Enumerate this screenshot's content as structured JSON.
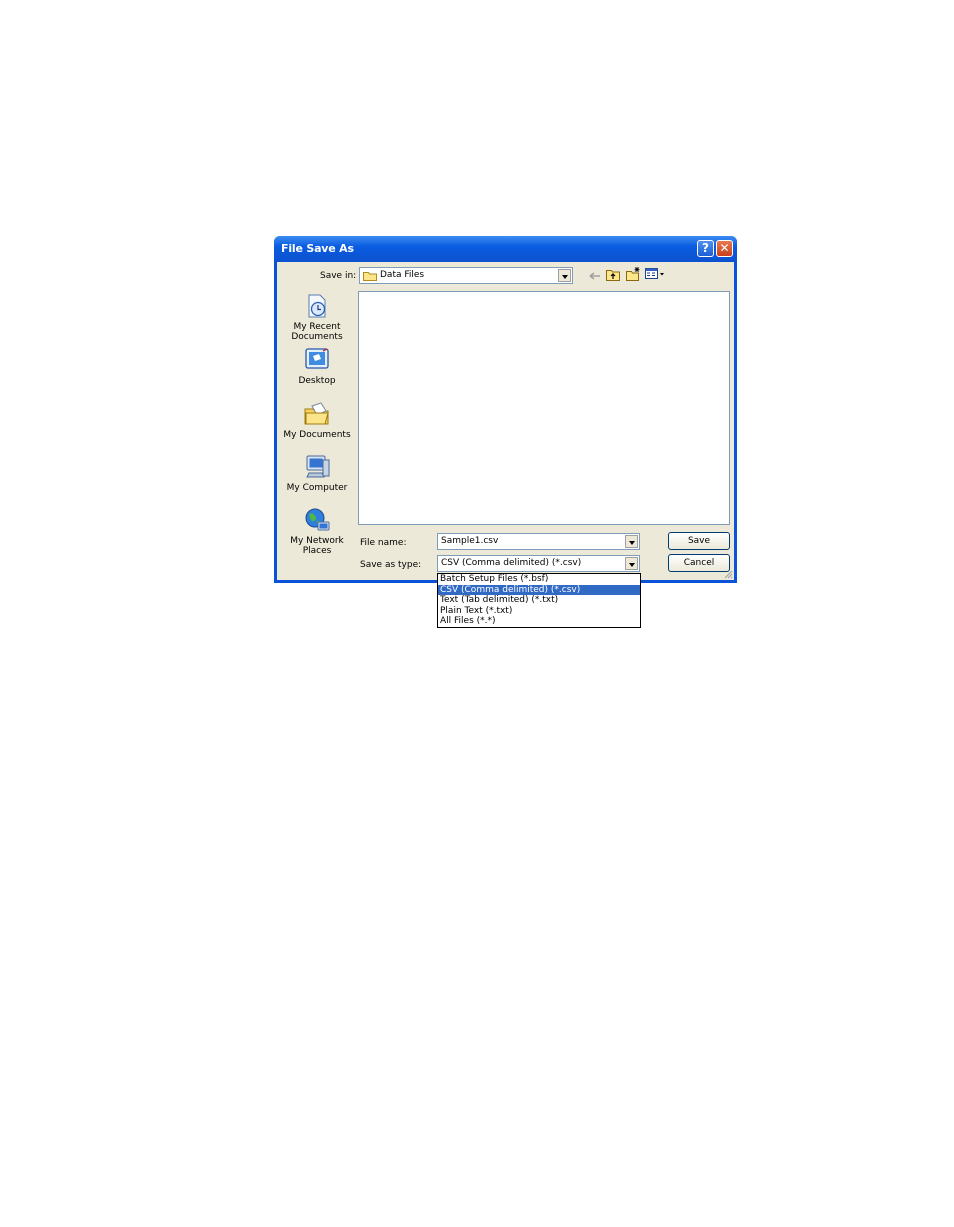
{
  "dialog": {
    "title": "File Save As",
    "help_glyph": "?",
    "close_glyph": "✕"
  },
  "save_in": {
    "label": "Save in:",
    "value": "Data Files"
  },
  "toolbar": {
    "icons": [
      "back-arrow-icon",
      "up-folder-icon",
      "new-folder-icon",
      "views-menu-icon"
    ]
  },
  "places": [
    {
      "label": "My Recent Documents",
      "line1": "My Recent",
      "line2": "Documents",
      "icon": "recent-documents-icon"
    },
    {
      "label": "Desktop",
      "line1": "Desktop",
      "line2": "",
      "icon": "desktop-icon"
    },
    {
      "label": "My Documents",
      "line1": "My Documents",
      "line2": "",
      "icon": "my-documents-icon"
    },
    {
      "label": "My Computer",
      "line1": "My Computer",
      "line2": "",
      "icon": "my-computer-icon"
    },
    {
      "label": "My Network Places",
      "line1": "My Network",
      "line2": "Places",
      "icon": "network-places-icon"
    }
  ],
  "file_name": {
    "label": "File name:",
    "value": "Sample1.csv"
  },
  "save_as_type": {
    "label": "Save as type:",
    "value": "CSV (Comma delimited) (*.csv)",
    "options": [
      "Batch Setup Files (*.bsf)",
      "CSV (Comma delimited) (*.csv)",
      "Text (Tab delimited) (*.txt)",
      "Plain Text (*.txt)",
      "All Files (*.*)"
    ],
    "selected_index": 1
  },
  "buttons": {
    "save": "Save",
    "cancel": "Cancel"
  },
  "colors": {
    "titlebar": "#0a5ce0",
    "selection": "#316ac5",
    "dialog_face": "#ece9d8"
  }
}
